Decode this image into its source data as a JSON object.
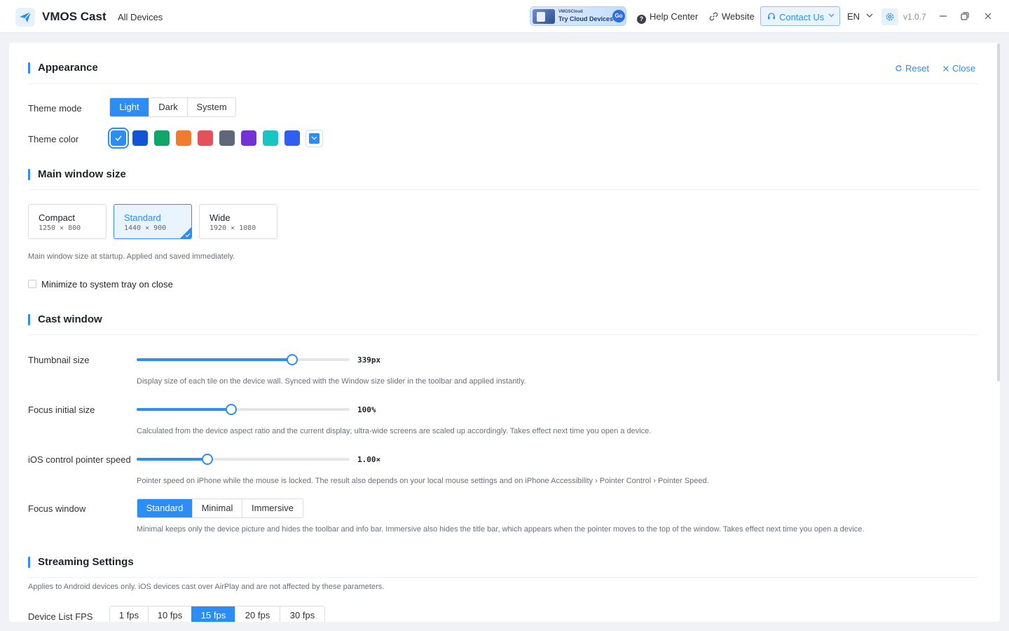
{
  "app": {
    "name": "VMOS Cast",
    "nav_all": "All Devices",
    "version": "v1.0.7",
    "accent": "#2b8df5"
  },
  "promo": {
    "small": "VMOSCloud",
    "big": "Try Cloud Devices",
    "go": "Go"
  },
  "header": {
    "help": "Help Center",
    "website": "Website",
    "contact": "Contact Us",
    "lang": "EN"
  },
  "appearance": {
    "title": "Appearance",
    "reset": "Reset",
    "close": "Close",
    "theme_mode_label": "Theme mode",
    "theme_modes": [
      "Light",
      "Dark",
      "System"
    ],
    "theme_mode_selected": "Light",
    "theme_color_label": "Theme color",
    "theme_colors": [
      "#2b8df5",
      "#1254d6",
      "#10a56b",
      "#ef7d2f",
      "#e5505a",
      "#5f6877",
      "#7432d4",
      "#1cc3c3",
      "#2f5ff0"
    ],
    "theme_color_selected": "#2b8df5"
  },
  "main_window": {
    "title": "Main window size",
    "sizes": [
      {
        "name": "Compact",
        "dim": "1250 × 800"
      },
      {
        "name": "Standard",
        "dim": "1440 × 900"
      },
      {
        "name": "Wide",
        "dim": "1920 × 1080"
      }
    ],
    "selected": "Standard",
    "hint": "Main window size at startup. Applied and saved immediately.",
    "tray_label": "Minimize to system tray on close",
    "tray_checked": false
  },
  "cast_window": {
    "title": "Cast window",
    "thumb_label": "Thumbnail size",
    "thumb_value": "339px",
    "thumb_fraction": 0.73,
    "thumb_hint": "Display size of each tile on the device wall. Synced with the Window size slider in the toolbar and applied instantly.",
    "focus_label": "Focus initial size",
    "focus_value": "100%",
    "focus_fraction": 0.443,
    "focus_hint": "Calculated from the device aspect ratio and the current display; ultra-wide screens are scaled up accordingly. Takes effect next time you open a device.",
    "ios_label": "iOS control pointer speed",
    "ios_value": "1.00×",
    "ios_fraction": 0.332,
    "ios_hint": "Pointer speed on iPhone while the mouse is locked. The result also depends on your local mouse settings and on iPhone Accessibility › Pointer Control › Pointer Speed.",
    "fw_label": "Focus window",
    "fw_modes": [
      "Standard",
      "Minimal",
      "Immersive"
    ],
    "fw_selected": "Standard",
    "fw_hint": "Minimal keeps only the device picture and hides the toolbar and info bar. Immersive also hides the title bar, which appears when the pointer moves to the top of the window. Takes effect next time you open a device."
  },
  "streaming": {
    "title": "Streaming Settings",
    "hint": "Applies to Android devices only. iOS devices cast over AirPlay and are not affected by these parameters.",
    "fps_label": "Device List FPS",
    "fps_options": [
      "1 fps",
      "10 fps",
      "15 fps",
      "20 fps",
      "30 fps"
    ],
    "fps_selected": "15 fps"
  }
}
